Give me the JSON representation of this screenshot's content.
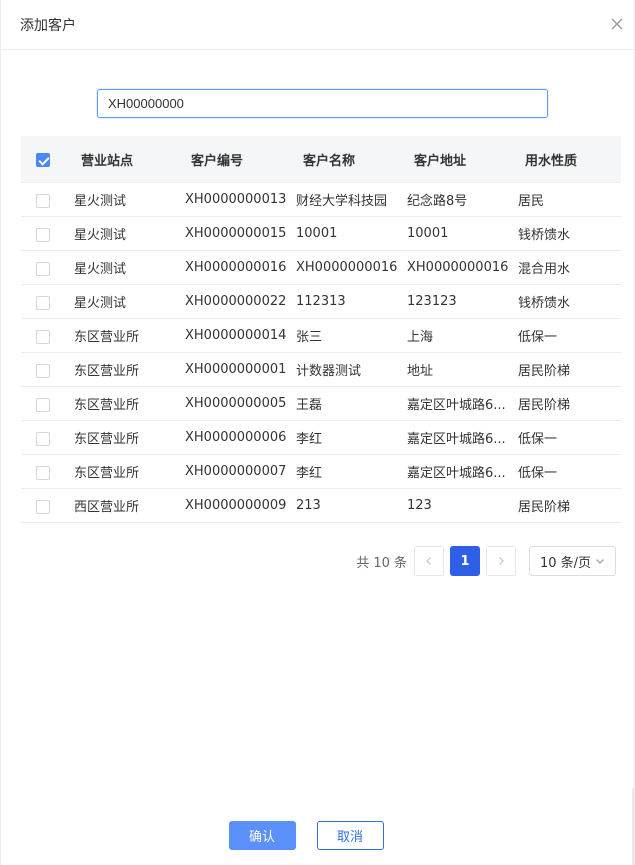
{
  "dialog": {
    "title": "添加客户"
  },
  "search": {
    "value": "XH00000000"
  },
  "table": {
    "headers": [
      "营业站点",
      "客户编号",
      "客户名称",
      "客户地址",
      "用水性质"
    ],
    "rows": [
      [
        "星火测试",
        "XH0000000013",
        "财经大学科技园",
        "纪念路8号",
        "居民"
      ],
      [
        "星火测试",
        "XH0000000015",
        "10001",
        "10001",
        "钱桥馈水"
      ],
      [
        "星火测试",
        "XH0000000016",
        "XH0000000016",
        "XH0000000016",
        "混合用水"
      ],
      [
        "星火测试",
        "XH0000000022",
        "112313",
        "123123",
        "钱桥馈水"
      ],
      [
        "东区营业所",
        "XH0000000014",
        "张三",
        "上海",
        "低保一"
      ],
      [
        "东区营业所",
        "XH0000000001",
        "计数器测试",
        "地址",
        "居民阶梯"
      ],
      [
        "东区营业所",
        "XH0000000005",
        "王磊",
        "嘉定区叶城路6...",
        "居民阶梯"
      ],
      [
        "东区营业所",
        "XH0000000006",
        "李红",
        "嘉定区叶城路6...",
        "低保一"
      ],
      [
        "东区营业所",
        "XH0000000007",
        "李红",
        "嘉定区叶城路6...",
        "低保一"
      ],
      [
        "西区营业所",
        "XH0000000009",
        "213",
        "123",
        "居民阶梯"
      ]
    ]
  },
  "pagination": {
    "total_label": "共 10 条",
    "current_page": "1",
    "page_size_label": "10 条/页"
  },
  "footer": {
    "confirm_label": "确认",
    "cancel_label": "取消"
  },
  "colors": {
    "primary": "#2f5fe6",
    "confirm_bg": "#5b8ff9",
    "checkbox_checked": "#4a88f5"
  },
  "icons": [
    "close-icon",
    "chevron-left-icon",
    "chevron-right-icon",
    "chevron-down-icon",
    "check-icon"
  ]
}
